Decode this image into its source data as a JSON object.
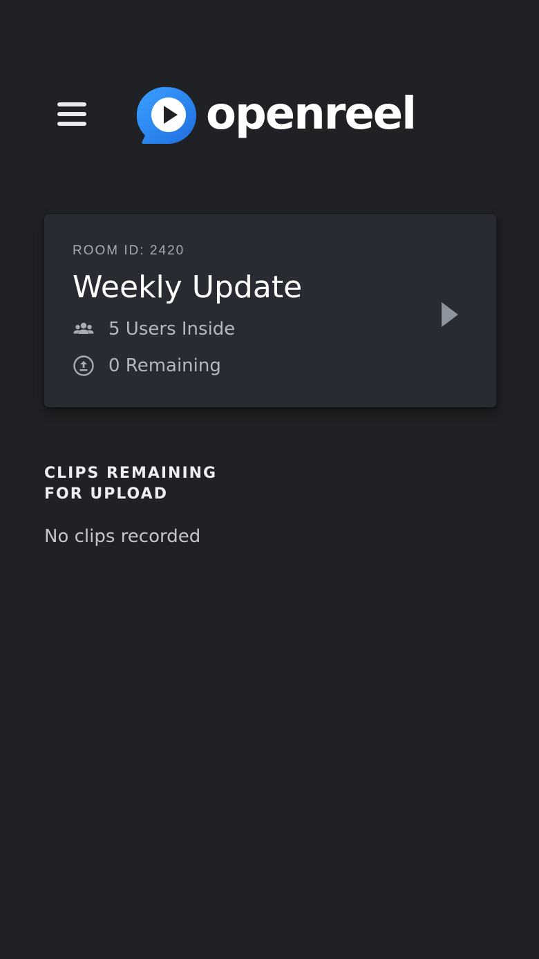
{
  "header": {
    "menu_icon": "hamburger-menu-icon",
    "logo_icon": "play-bubble-logo-icon",
    "brand_name": "openreel",
    "brand_color": "#2f8cf0"
  },
  "room": {
    "id_label": "ROOM ID: 2420",
    "title": "Weekly Update",
    "users_icon": "users-group-icon",
    "users_text": "5 Users Inside",
    "remaining_icon": "upload-circle-icon",
    "remaining_text": "0 Remaining",
    "open_icon": "chevron-right-icon"
  },
  "clips": {
    "heading_line1": "CLIPS REMAINING",
    "heading_line2": "FOR UPLOAD",
    "empty_text": "No clips recorded"
  },
  "colors": {
    "background": "#202124",
    "card": "#282b31",
    "accent": "#2f8cf0"
  }
}
